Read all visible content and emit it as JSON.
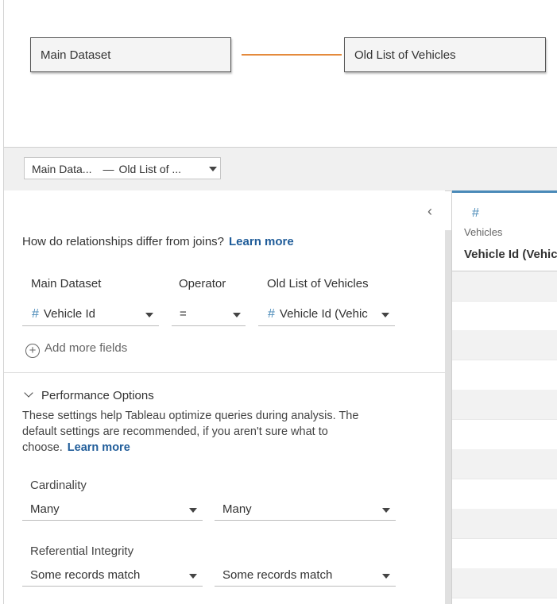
{
  "canvas": {
    "left_table": "Main Dataset",
    "right_table": "Old List of Vehicles"
  },
  "relationship_selector": {
    "left": "Main Data...",
    "separator": "—",
    "right": "Old List of ..."
  },
  "panel": {
    "question": "How do relationships differ from joins?",
    "learn_more": "Learn more",
    "columns": {
      "left": "Main Dataset",
      "operator": "Operator",
      "right": "Old List of Vehicles"
    },
    "clause": {
      "left_field": "Vehicle Id",
      "operator": "=",
      "right_field": "Vehicle Id (Vehic"
    },
    "add_more": "Add more fields",
    "performance": {
      "title": "Performance Options",
      "description": "These settings help Tableau optimize queries during analysis. The default settings are recommended, if you aren't sure what to choose.",
      "learn_more": "Learn more",
      "cardinality_label": "Cardinality",
      "cardinality_left": "Many",
      "cardinality_right": "Many",
      "integrity_label": "Referential Integrity",
      "integrity_left": "Some records match",
      "integrity_right": "Some records match"
    }
  },
  "grid": {
    "source": "Vehicles",
    "column": "Vehicle Id (Vehic"
  },
  "colors": {
    "accent": "#4a8ab8",
    "link": "#1f5c99",
    "connector": "#e48a3c"
  }
}
